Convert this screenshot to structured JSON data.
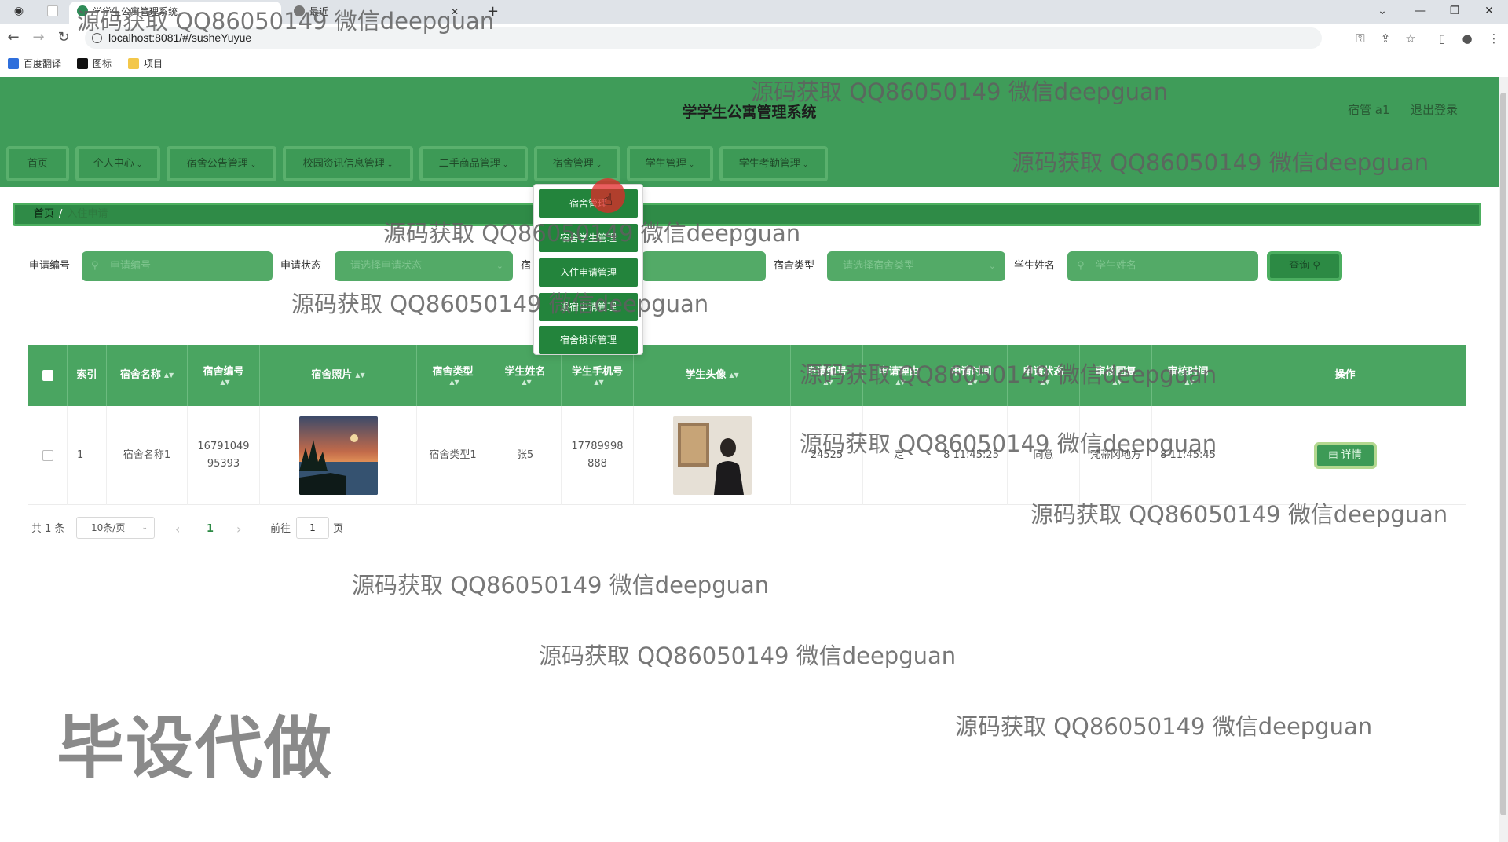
{
  "browser": {
    "tabs": [
      {
        "title": "学学生公寓管理系统"
      },
      {
        "title": "最近"
      }
    ],
    "new_tab": "+",
    "url": "localhost:8081/#/susheYuyue",
    "bookmarks": [
      "百度翻译",
      "图标",
      "项目"
    ]
  },
  "app": {
    "title": "学学生公寓管理系统",
    "user": "宿管 a1",
    "logout": "退出登录"
  },
  "nav": {
    "items": [
      {
        "label": "首页",
        "chevron": false
      },
      {
        "label": "个人中心",
        "chevron": true
      },
      {
        "label": "宿舍公告管理",
        "chevron": true
      },
      {
        "label": "校园资讯信息管理",
        "chevron": true
      },
      {
        "label": "二手商品管理",
        "chevron": true
      },
      {
        "label": "宿舍管理",
        "chevron": true
      },
      {
        "label": "学生管理",
        "chevron": true
      },
      {
        "label": "学生考勤管理",
        "chevron": true
      }
    ],
    "chevron_glyph": "⌄",
    "dropdown": [
      "宿舍管理",
      "宿舍学生管理",
      "入住申请管理",
      "退宿申请管理",
      "宿舍投诉管理"
    ]
  },
  "breadcrumb": {
    "home": "首页",
    "separator": "/",
    "current": "入住申请"
  },
  "search": {
    "fields": [
      {
        "label": "申请编号",
        "placeholder": "申请编号",
        "type": "input"
      },
      {
        "label": "申请状态",
        "placeholder": "请选择申请状态",
        "type": "select"
      },
      {
        "label": "宿",
        "placeholder": "",
        "type": "input"
      },
      {
        "label": "宿舍类型",
        "placeholder": "请选择宿舍类型",
        "type": "select"
      },
      {
        "label": "学生姓名",
        "placeholder": "学生姓名",
        "type": "input"
      }
    ],
    "query_button": "查询"
  },
  "table": {
    "columns": [
      {
        "label": "",
        "sortable": false
      },
      {
        "label": "索引",
        "sortable": false
      },
      {
        "label": "宿舍名称",
        "sortable": true
      },
      {
        "label": "宿舍编号",
        "sortable": true
      },
      {
        "label": "宿舍照片",
        "sortable": true
      },
      {
        "label": "宿舍类型",
        "sortable": true
      },
      {
        "label": "学生姓名",
        "sortable": true
      },
      {
        "label": "学生手机号",
        "sortable": true
      },
      {
        "label": "学生头像",
        "sortable": true
      },
      {
        "label": "申请编号",
        "sortable": true
      },
      {
        "label": "申请理由",
        "sortable": true
      },
      {
        "label": "申请时间",
        "sortable": true
      },
      {
        "label": "申请状态",
        "sortable": true
      },
      {
        "label": "审核回复",
        "sortable": true
      },
      {
        "label": "审核时间",
        "sortable": true
      },
      {
        "label": "操作",
        "sortable": false
      }
    ],
    "sort_glyph": "▲▼",
    "rows": [
      {
        "index": "1",
        "dorm_name": "宿舍名称1",
        "dorm_no": "16791049 95393",
        "dorm_type": "宿舍类型1",
        "student_name": "张5",
        "student_phone": "17789998 888",
        "apply_no": "24525",
        "apply_reason": "定",
        "apply_time": "8 11:45:25",
        "status": "同意",
        "reply": "梵蒂冈地方",
        "review_time": "8 11:45:45",
        "action": "详情"
      }
    ]
  },
  "pagination": {
    "total": "共 1 条",
    "page_size": "10条/页",
    "prev": "‹",
    "current": "1",
    "next": "›",
    "goto_label": "前往",
    "goto_value": "1",
    "page_suffix": "页"
  },
  "watermarks": {
    "text": "源码获取 QQ86050149 微信deepguan",
    "big": "毕设代做"
  },
  "colors": {
    "header_green": "#3f9c59",
    "button_green": "#23843c",
    "input_green": "#53aa67"
  }
}
